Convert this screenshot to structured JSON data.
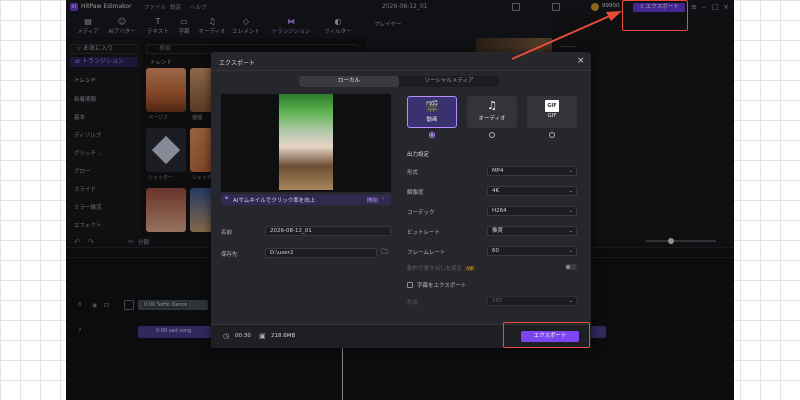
{
  "app": {
    "logo_text": "97",
    "name": "HitPaw Edimakor",
    "menu": [
      "ファイル",
      "設定",
      "ヘルプ"
    ],
    "project_title": "2026-08-12_01",
    "coins": "99900",
    "export_label": "エクスポート"
  },
  "toolbar": {
    "items": [
      {
        "label": "メディア",
        "icon": "media-icon"
      },
      {
        "label": "AIアバター",
        "icon": "avatar-icon"
      },
      {
        "label": "テキスト",
        "icon": "text-icon"
      },
      {
        "label": "字幕",
        "icon": "subtitle-icon"
      },
      {
        "label": "オーディオ",
        "icon": "audio-icon"
      },
      {
        "label": "エレメント",
        "icon": "element-icon"
      },
      {
        "label": "トランジション",
        "icon": "transition-icon"
      },
      {
        "label": "フィルター",
        "icon": "filter-icon"
      }
    ]
  },
  "left_nav": {
    "favorites": "お気に入り",
    "transition": "トランジション",
    "items": [
      "トレンド",
      "新着情報",
      "基本",
      "ディゾルブ",
      "グリッチ",
      "グロー",
      "スライド",
      "ミラー輪活",
      "エフェクト"
    ]
  },
  "content": {
    "search_placeholder": "検索",
    "section": "トレンド",
    "thumbs": [
      "ページフ",
      "揺揺",
      "シャッター",
      "シャッター"
    ]
  },
  "player": {
    "title": "プレイヤー"
  },
  "timeline": {
    "split_label": "分割",
    "clip_video": "0:00 SoHo Dance",
    "clip_audio": "0:00 sad song",
    "track_numbers": [
      "8",
      "7"
    ]
  },
  "modal": {
    "title": "エクスポート",
    "tabs": [
      "ローカル",
      "ソーシャルメディア"
    ],
    "ai_banner": "AIサムネイルでクリック率を向上",
    "ai_start": "開始",
    "name_label": "名前",
    "name_value": "2026-08-12_01",
    "save_label": "保存先",
    "save_value": "D:\\user2",
    "formats": [
      {
        "label": "動画",
        "icon": "video-icon",
        "selected": true
      },
      {
        "label": "オーディオ",
        "icon": "music-note-icon",
        "selected": false
      },
      {
        "label": "GIF",
        "icon": "gif-icon",
        "selected": false
      }
    ],
    "gif_badge": "GIF",
    "settings_title": "出力設定",
    "settings": [
      {
        "label": "形式",
        "value": "MP4"
      },
      {
        "label": "解像度",
        "value": "4K"
      },
      {
        "label": "コーデック",
        "value": "H264"
      },
      {
        "label": "ビットレート",
        "value": "推奨"
      },
      {
        "label": "フレームレート",
        "value": "60"
      }
    ],
    "accel_label": "動的で書き出しを促生",
    "vip": "VIP",
    "subtitle_export": "字幕をエクスポート",
    "subtitle_format_label": "形式",
    "subtitle_format_value": "SRT",
    "duration": "00:30",
    "filesize": "218.6MB",
    "export_button": "エクスポート"
  },
  "colors": {
    "accent": "#7b46f0",
    "highlight": "#e74c3c"
  }
}
